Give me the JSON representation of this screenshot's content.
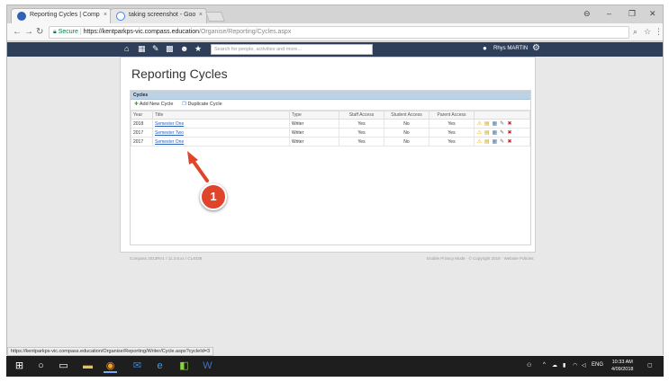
{
  "browser": {
    "tabs": [
      {
        "title": "Reporting Cycles | Comp",
        "close": "×"
      },
      {
        "title": "taking screenshot - Goo",
        "close": "×"
      }
    ],
    "window_controls": [
      "⊖",
      "–",
      "❐",
      "✕"
    ],
    "secure_label": "Secure",
    "url_host": "https://kentparkps-vic.compass.education",
    "url_path": "/Organise/Reporting/Cycles.aspx",
    "status_url": "https://kentparkps-vic.compass.education/Organise/Reporting/Writer/Cycle.aspx?cycleId=3"
  },
  "app": {
    "search_placeholder": "Search for people, activities and more...",
    "user_name": "Rhys MARTIN"
  },
  "page": {
    "title": "Reporting Cycles",
    "grid_title": "Cycles",
    "toolbar": {
      "add_label": "Add New Cycle",
      "duplicate_label": "Duplicate Cycle"
    },
    "columns": [
      "Year",
      "Title",
      "Type",
      "Staff Access",
      "Student Access",
      "Parent Access"
    ],
    "rows": [
      {
        "year": "2018",
        "title": "Semester One",
        "type": "Writer",
        "staff": "Yes",
        "student": "No",
        "parent": "Yes"
      },
      {
        "year": "2017",
        "title": "Semester Two",
        "type": "Writer",
        "staff": "Yes",
        "student": "No",
        "parent": "Yes"
      },
      {
        "year": "2017",
        "title": "Semester One",
        "type": "Writer",
        "staff": "Yes",
        "student": "No",
        "parent": "Yes"
      }
    ],
    "footer_left": "Compass 2013RV1 / 11.3.8.xx / CL4038",
    "footer_right": "Enable Privacy Mode · © Copyright 2018 · Website Policies"
  },
  "annotation": {
    "callout_number": "1"
  },
  "taskbar": {
    "tray_lang": "ENG",
    "clock_time": "10:33 AM",
    "clock_date": "4/09/2018"
  },
  "colors": {
    "app_bar": "#2f3f59",
    "grid_header": "#bcd3e6",
    "callout": "#e0442b",
    "link": "#2f62b5"
  }
}
